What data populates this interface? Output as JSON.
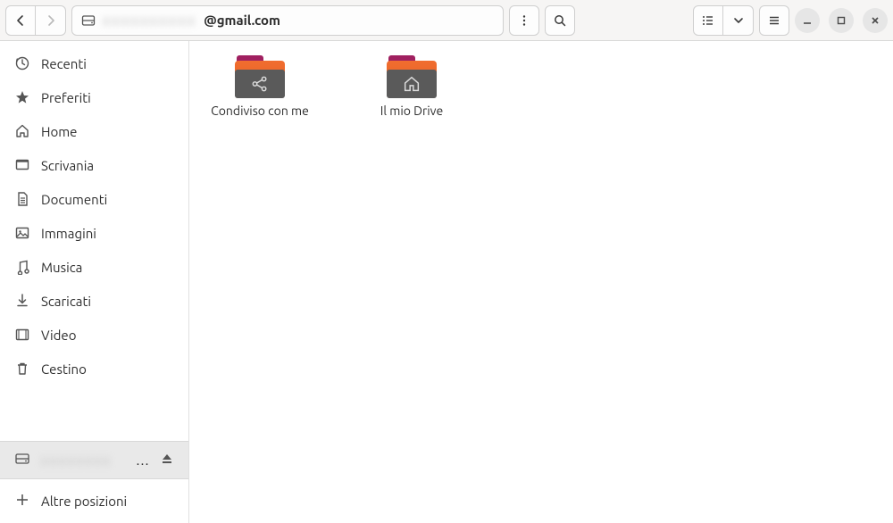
{
  "pathbar": {
    "obscured": "xxxxxxxxxx",
    "suffix": "@gmail.com"
  },
  "sidebar": {
    "items": [
      {
        "label": "Recenti",
        "icon": "clock"
      },
      {
        "label": "Preferiti",
        "icon": "star"
      },
      {
        "label": "Home",
        "icon": "home"
      },
      {
        "label": "Scrivania",
        "icon": "desktop"
      },
      {
        "label": "Documenti",
        "icon": "document"
      },
      {
        "label": "Immagini",
        "icon": "image"
      },
      {
        "label": "Musica",
        "icon": "music"
      },
      {
        "label": "Scaricati",
        "icon": "download"
      },
      {
        "label": "Video",
        "icon": "video"
      },
      {
        "label": "Cestino",
        "icon": "trash"
      }
    ],
    "drive": {
      "obscured": "xxxxxxxx",
      "ellipsis": "…"
    },
    "other": "Altre posizioni"
  },
  "folders": [
    {
      "label": "Condiviso con me",
      "emblem": "share"
    },
    {
      "label": "Il mio Drive",
      "emblem": "home"
    }
  ]
}
